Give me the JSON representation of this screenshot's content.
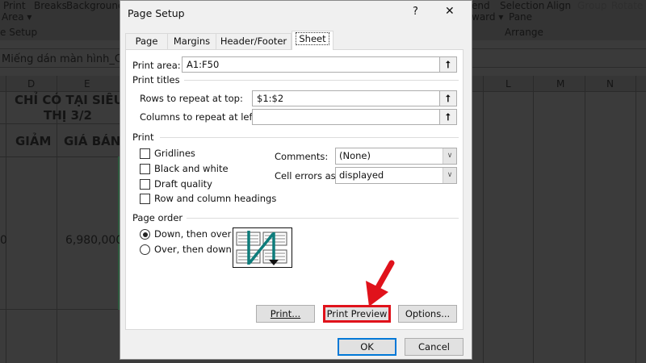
{
  "background": {
    "ribbon": {
      "print_area": "Print",
      "print_area2": "Area ▾",
      "breaks": "Breaks",
      "background": "Background",
      "group_page_setup": "e Setup",
      "send_backward": "end",
      "send_backward2": "ward ▾",
      "selection_pane": "Selection",
      "selection_pane2": "Pane",
      "align": "Align",
      "group": "Group",
      "rotate": "Rotate",
      "group_arrange": "Arrange"
    },
    "formula_bar": "Miếng dán màn hình_Ch",
    "columns": [
      "D",
      "E",
      "L",
      "M",
      "N"
    ],
    "cells": {
      "header1_line1": "CHỈ CÓ TẠI SIÊU",
      "header1_line2": "THỊ 3/2",
      "giam": "GIẢM",
      "gia_ban": "GIÁ BÁN",
      "partial_value": "0",
      "price": "6,980,000"
    }
  },
  "dialog": {
    "title": "Page Setup",
    "help": "?",
    "close": "✕",
    "tabs": [
      {
        "label": "Page",
        "selected": false
      },
      {
        "label": "Margins",
        "selected": false
      },
      {
        "label": "Header/Footer",
        "selected": false
      },
      {
        "label": "Sheet",
        "selected": true
      }
    ],
    "print_area": {
      "label": "Print area:",
      "value": "A1:F50"
    },
    "print_titles": {
      "heading": "Print titles",
      "rows_label": "Rows to repeat at top:",
      "rows_value": "$1:$2",
      "cols_label": "Columns to repeat at left:",
      "cols_value": ""
    },
    "print": {
      "heading": "Print",
      "checkboxes": [
        {
          "label": "Gridlines",
          "checked": false
        },
        {
          "label": "Black and white",
          "checked": false
        },
        {
          "label": "Draft quality",
          "checked": false
        },
        {
          "label": "Row and column headings",
          "checked": false
        }
      ],
      "comments_label": "Comments:",
      "comments_value": "(None)",
      "errors_label": "Cell errors as:",
      "errors_value": "displayed"
    },
    "page_order": {
      "heading": "Page order",
      "options": [
        {
          "label": "Down, then over",
          "selected": true
        },
        {
          "label": "Over, then down",
          "selected": false
        }
      ]
    },
    "buttons": {
      "print": "Print...",
      "print_preview": "Print Preview",
      "options": "Options...",
      "ok": "OK",
      "cancel": "Cancel"
    },
    "colors": {
      "highlight": "#e0121b",
      "ok_border": "#0078d7",
      "diagram_arrow": "#0e7c7b"
    }
  }
}
